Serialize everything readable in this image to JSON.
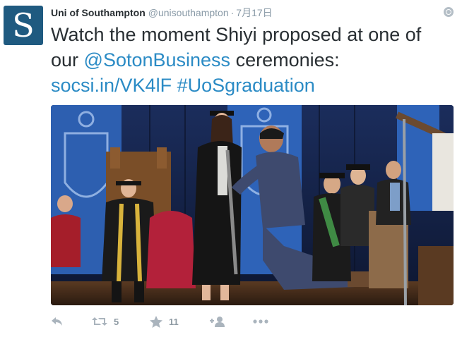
{
  "tweet": {
    "avatar_letter": "S",
    "author_name": "Uni of Southampton",
    "author_handle": "@unisouthampton",
    "separator": "·",
    "date": "7月17日",
    "text_part1": "Watch the moment Shiyi proposed at one of our ",
    "mention": "@SotonBusiness",
    "text_part2": " ceremonies:",
    "url": "socsi.in/VK4lF",
    "hashtag": "#UoSgraduation",
    "photo_icon": "graduation-proposal-photo"
  },
  "actions": {
    "reply_icon": "reply-icon",
    "retweet_icon": "retweet-icon",
    "retweet_count": "5",
    "favorite_icon": "star-icon",
    "favorite_count": "11",
    "follow_icon": "follow-icon",
    "more_icon": "more-icon"
  },
  "colors": {
    "link": "#2b8bc5",
    "text": "#292f33",
    "muted": "#8899a6",
    "avatar_bg": "#1f5a80"
  }
}
